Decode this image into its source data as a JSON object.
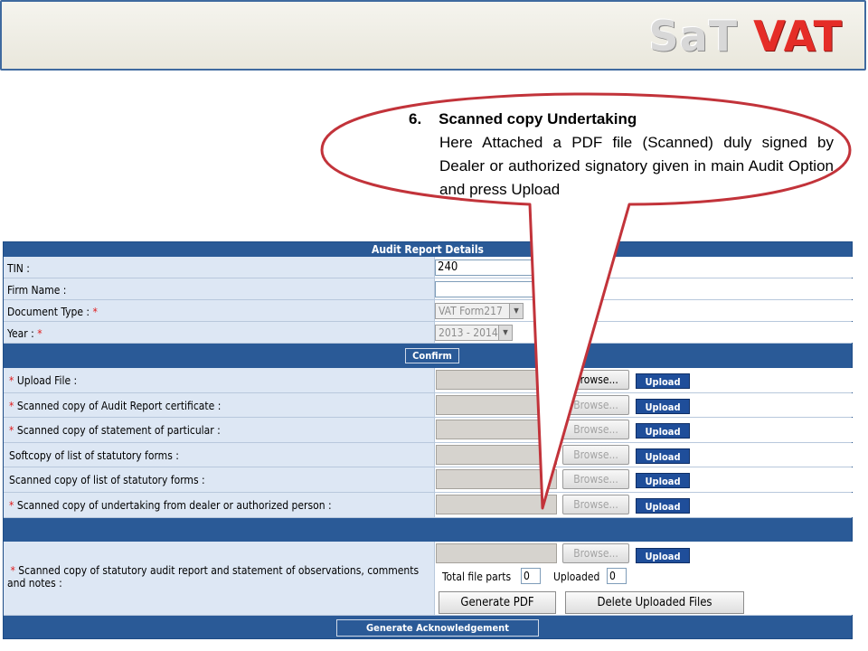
{
  "header": {
    "logo_sat": "SaT",
    "logo_vat": "VAT"
  },
  "callout": {
    "number": "6.",
    "heading": "Scanned copy Undertaking",
    "body": "Here Attached a PDF file (Scanned) duly signed by Dealer or authorized signatory given in main Audit Option and press Upload"
  },
  "form": {
    "title": "Audit Report Details",
    "tin_label": "TIN :",
    "tin_value": "240",
    "firm_label": "Firm Name :",
    "firm_value": "",
    "doctype_label": "Document Type :",
    "doctype_value": "VAT Form217",
    "year_label": "Year :",
    "year_value": "2013 - 2014",
    "required_mark": "*",
    "confirm_label": "Confirm",
    "browse_label": "Browse...",
    "upload_label": "Upload",
    "uploads": [
      {
        "label": "Upload File :",
        "required": true
      },
      {
        "label": "Scanned copy of Audit Report certificate :",
        "required": true
      },
      {
        "label": "Scanned copy of statement of particular :",
        "required": true
      },
      {
        "label": "Softcopy of list of statutory forms :",
        "required": false
      },
      {
        "label": "Scanned copy of list of statutory forms :",
        "required": false
      },
      {
        "label": "Scanned copy of undertaking from dealer or authorized person :",
        "required": true
      }
    ],
    "statutory_label": "Scanned copy of statutory audit report and statement of observations, comments and notes :",
    "total_parts_label": "Total file parts",
    "total_parts_value": "0",
    "uploaded_label": "Uploaded",
    "uploaded_value": "0",
    "generate_pdf_label": "Generate PDF",
    "delete_files_label": "Delete Uploaded Files",
    "ack_label": "Generate Acknowledgement"
  }
}
